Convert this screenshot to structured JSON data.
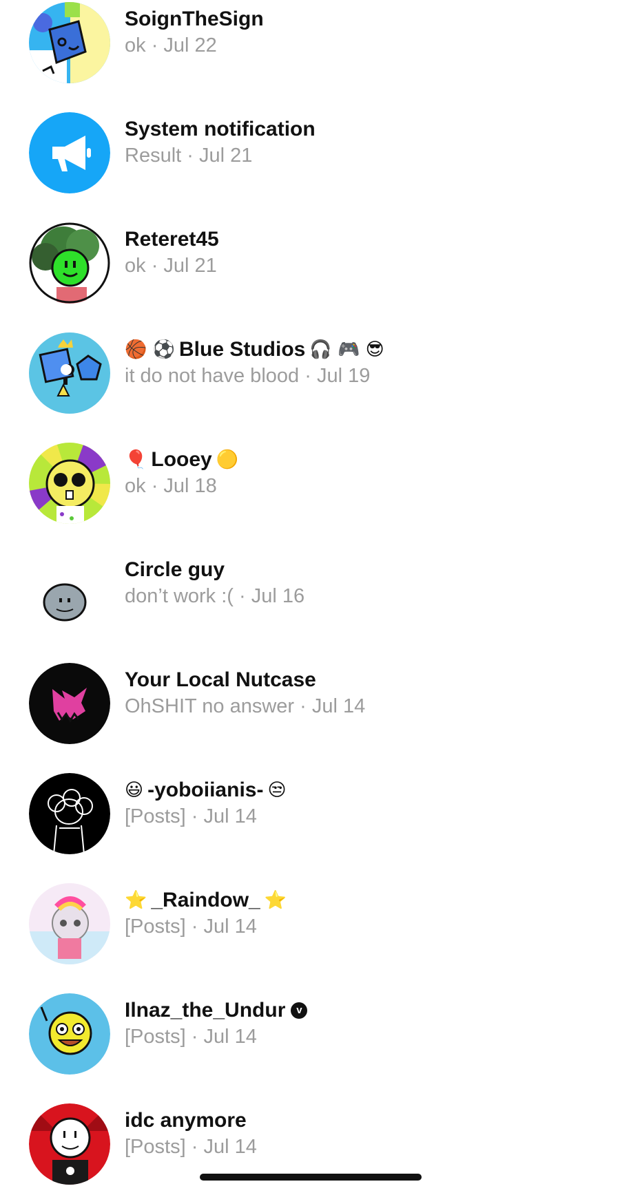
{
  "conversations": [
    {
      "name": "SoignTheSign",
      "prefix": "",
      "suffix": "",
      "preview": "ok",
      "sep": " · ",
      "date": "Jul 22",
      "avatar": "shape-cartoon-avatar"
    },
    {
      "name": "System notification",
      "prefix": "",
      "suffix": "",
      "preview": "Result",
      "sep": " · ",
      "date": "Jul 21",
      "avatar": "megaphone-icon"
    },
    {
      "name": "Reteret45",
      "prefix": "",
      "suffix": "",
      "preview": "ok",
      "sep": " · ",
      "date": "Jul 21",
      "avatar": "green-character-avatar"
    },
    {
      "name": "Blue Studios",
      "prefix": "🏀 ⚽",
      "suffix": "🎧 🎮 😎",
      "preview": "it do not have blood",
      "sep": " · ",
      "date": "Jul 19",
      "avatar": "blue-shapes-avatar"
    },
    {
      "name": "Looey",
      "prefix": "🎈",
      "suffix": "🟡",
      "preview": "ok",
      "sep": " · ",
      "date": "Jul 18",
      "avatar": "yellow-character-avatar"
    },
    {
      "name": "Circle guy",
      "prefix": "",
      "suffix": "",
      "preview": "don’t work :(",
      "sep": " · ",
      "date": "Jul 16",
      "avatar": "grey-circle-avatar"
    },
    {
      "name": "Your Local Nutcase",
      "prefix": "",
      "suffix": "",
      "preview": "OhSHIT no answer",
      "sep": " · ",
      "date": "Jul 14",
      "avatar": "pink-face-avatar"
    },
    {
      "name": "-yoboiianis-",
      "prefix": "😃",
      "suffix": "😒",
      "preview": "[Posts]",
      "sep": " · ",
      "date": "Jul 14",
      "avatar": "sketch-avatar"
    },
    {
      "name": "_Raindow_",
      "prefix": "⭐",
      "suffix": "⭐",
      "preview": "[Posts]",
      "sep": " · ",
      "date": "Jul 14",
      "avatar": "rainbow-avatar"
    },
    {
      "name": "Ilnaz_the_Undur",
      "prefix": "",
      "suffix": "",
      "badge": "v",
      "preview": "[Posts]",
      "sep": " · ",
      "date": "Jul 14",
      "avatar": "smiley-avatar"
    },
    {
      "name": "idc anymore",
      "prefix": "",
      "suffix": "",
      "preview": "[Posts]",
      "sep": " · ",
      "date": "Jul 14",
      "avatar": "red-character-avatar"
    }
  ]
}
